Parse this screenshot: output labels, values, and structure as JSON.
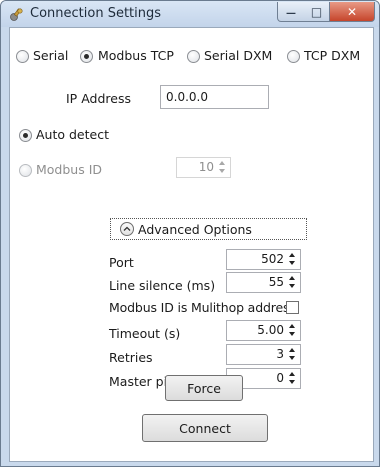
{
  "window": {
    "title": "Connection Settings",
    "min_glyph": "—",
    "max_glyph": "□",
    "close_glyph": "✕",
    "icons": [
      "app-icon",
      "minimize-icon",
      "maximize-icon",
      "close-icon"
    ]
  },
  "connection_types": [
    {
      "label": "Serial",
      "selected": false
    },
    {
      "label": "Modbus TCP",
      "selected": true
    },
    {
      "label": "Serial DXM",
      "selected": false
    },
    {
      "label": "TCP DXM",
      "selected": false
    }
  ],
  "ip": {
    "label": "IP Address",
    "value": "0.0.0.0"
  },
  "auto_detect": {
    "label": "Auto detect",
    "selected": true
  },
  "modbus_id": {
    "label": "Modbus ID",
    "value": "10",
    "selected": false,
    "enabled": false
  },
  "advanced": {
    "toggle_label": "Advanced Options",
    "expanded": true,
    "port": {
      "label": "Port",
      "value": "502"
    },
    "line_silence": {
      "label": "Line silence (ms)",
      "value": "55"
    },
    "multihop": {
      "label": "Modbus ID is Mulithop address",
      "checked": false
    },
    "timeout": {
      "label": "Timeout (s)",
      "value": "5.00"
    },
    "retries": {
      "label": "Retries",
      "value": "3"
    },
    "master_ping": {
      "label": "Master ping address",
      "value": "0"
    },
    "force_label": "Force"
  },
  "connect_label": "Connect",
  "colors": {
    "titlebar": "#c9d9ec",
    "close_button": "#c6452b",
    "disabled_text": "#8f8f8f"
  }
}
